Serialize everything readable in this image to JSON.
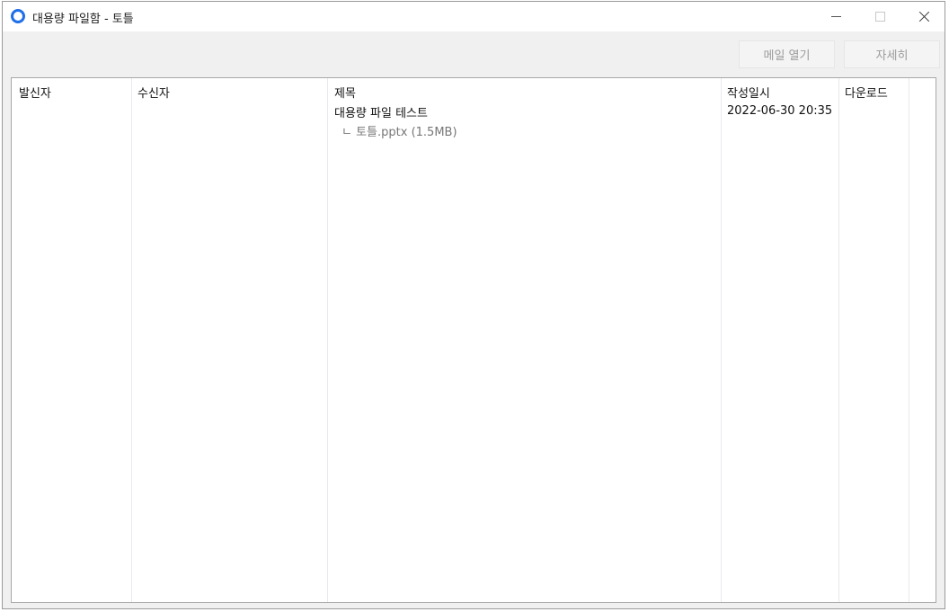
{
  "window": {
    "title": "대용량 파일함 - 토틀"
  },
  "toolbar": {
    "open_mail_label": "메일 열기",
    "detail_label": "자세히"
  },
  "table": {
    "columns": [
      "발신자",
      "수신자",
      "제목",
      "작성일시",
      "다운로드"
    ],
    "rows": [
      {
        "sender": "",
        "recipient": "",
        "subject": "대용량 파일 테스트",
        "attachment": "ㄴ 토틀.pptx (1.5MB)",
        "date": "2022-06-30 20:35",
        "download": ""
      }
    ]
  }
}
